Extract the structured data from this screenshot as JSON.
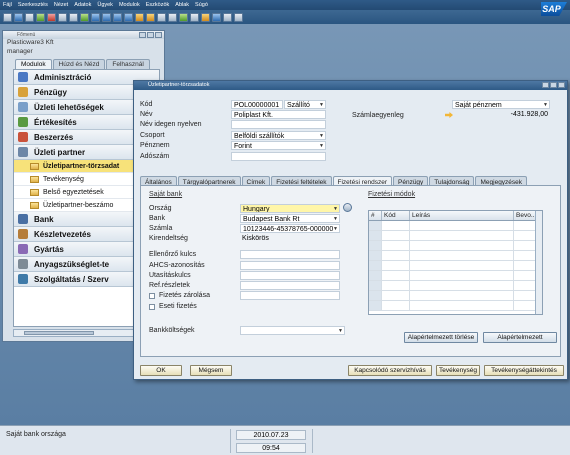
{
  "menubar": [
    "Fájl",
    "Szerkesztés",
    "Nézet",
    "Adatok",
    "Ügyek",
    "Modulok",
    "Eszközök",
    "Ablak",
    "Súgó"
  ],
  "logo": "SAP",
  "mainwin": {
    "title": "Főmenü",
    "company": "Plasticware3 Kft",
    "user": "manager",
    "tabs": [
      "Modulok",
      "Húzd és Nézd",
      "Felhasznál"
    ],
    "items": [
      {
        "label": "Adminisztráció",
        "color": "#4a78c4"
      },
      {
        "label": "Pénzügy",
        "color": "#d8a23b"
      },
      {
        "label": "Üzleti lehetőségek",
        "color": "#7a9fc9"
      },
      {
        "label": "Értékesítés",
        "color": "#5a9a42"
      },
      {
        "label": "Beszerzés",
        "color": "#c9523b"
      },
      {
        "label": "Üzleti partner",
        "color": "#6d87a7"
      }
    ],
    "subitems": [
      "Üzletipartner-törzsadat",
      "Tevékenység",
      "Belső egyeztetések",
      "Üzletipartner-beszámo"
    ],
    "items2": [
      {
        "label": "Bank",
        "color": "#496fa3"
      },
      {
        "label": "Készletvezetés",
        "color": "#b57d3a"
      },
      {
        "label": "Gyártás",
        "color": "#8a6ab5"
      },
      {
        "label": "Anyagszükséglet-te",
        "color": "#7e8b96"
      },
      {
        "label": "Szolgáltatás / Szerv",
        "color": "#3f7aa8"
      }
    ]
  },
  "dialog": {
    "title": "Üzletipartner-törzsadatok",
    "header": {
      "kod_label": "Kód",
      "kod_value": "POL00000001",
      "type_value": "Szállító",
      "nev_label": "Név",
      "nev_value": "Poliplast Kft.",
      "nev_idegen_label": "Név idegen nyelven",
      "csoport_label": "Csoport",
      "csoport_value": "Belföldi szállítók",
      "penznem_label": "Pénznem",
      "penznem_value": "Forint",
      "adoszam_label": "Adószám",
      "currency_select": "Saját pénznem",
      "szamlaegyenleg_label": "Számlaegyenleg",
      "szamlaegyenleg_value": "-431.928,00"
    },
    "tabs": [
      "Általános",
      "Tárgyalópartnerek",
      "Címek",
      "Fizetési feltételek",
      "Fizetési rendszer",
      "Pénzügy",
      "Tulajdonság",
      "Megjegyzések"
    ],
    "active_tab": "Fizetési rendszer",
    "bank": {
      "section": "Saját bank",
      "orszag_label": "Ország",
      "orszag_value": "Hungary",
      "bank_label": "Bank",
      "bank_value": "Budapest Bank Rt",
      "szamla_label": "Számla",
      "szamla_value": "10123446-45378765-000000",
      "kirendeltseg_label": "Kirendeltség",
      "kirendeltseg_value": "Kiskörös",
      "ellenorzo_label": "Ellenőrző kulcs",
      "ahcs_label": "AHCS-azonosítás",
      "utasitas_label": "Utasításkulcs",
      "ref_label": "Ref.részletek",
      "zarolas_label": "Fizetés zárolása",
      "eseti_label": "Eseti fizetés",
      "bankkoltseg_label": "Bankköltségek"
    },
    "payment": {
      "section": "Fizetési módok",
      "columns": [
        "#",
        "Kód",
        "Leírás",
        "Bevo..."
      ],
      "btn_delete_default": "Alapértelmezett törlése",
      "btn_default": "Alapértelmezett"
    },
    "footer": {
      "ok": "OK",
      "cancel": "Mégsem",
      "linked_service": "Kapcsolódó szervizhívás",
      "activity": "Tevékenység",
      "activity_report": "Tevékenységáttekintés"
    }
  },
  "status": {
    "message": "Saját bank országa",
    "date": "2010.07.23",
    "time": "09:54"
  }
}
